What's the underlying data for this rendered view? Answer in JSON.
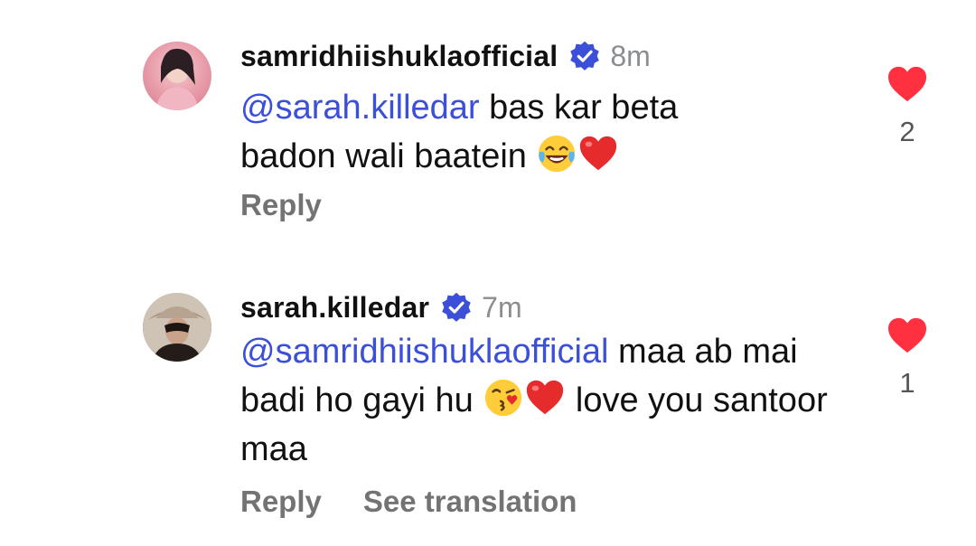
{
  "comments": [
    {
      "username": "samridhiishuklaofficial",
      "time": "8m",
      "mention": "@sarah.killedar",
      "text_before_emoji": " bas kar beta badon wali baatein ",
      "text_after_emoji": "",
      "emojis": [
        "laughing-tears-emoji",
        "red-heart-emoji"
      ],
      "likes": "2",
      "actions": [
        "Reply"
      ]
    },
    {
      "username": "sarah.killedar",
      "time": "7m",
      "mention": "@samridhiishuklaofficial",
      "text_before_emoji": " maa ab mai badi ho gayi hu ",
      "text_after_emoji": " love you santoor maa",
      "emojis": [
        "kissing-face-emoji",
        "red-heart-emoji"
      ],
      "likes": "1",
      "actions": [
        "Reply",
        "See translation"
      ]
    }
  ],
  "colors": {
    "mention": "#3b4fd8",
    "verified_badge": "#3b4fd8",
    "heart": "#ff3040",
    "muted": "#737373"
  }
}
